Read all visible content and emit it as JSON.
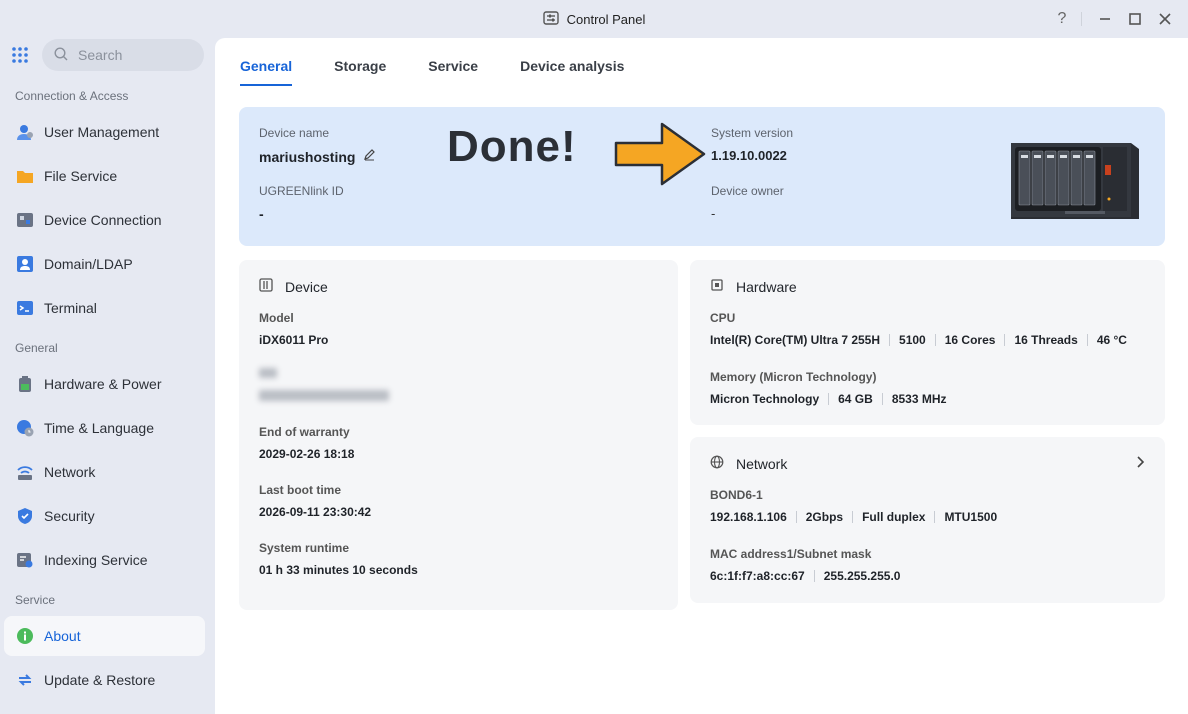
{
  "window": {
    "title": "Control Panel",
    "help": "?"
  },
  "search": {
    "placeholder": "Search"
  },
  "sidebar": {
    "sections": [
      "Connection & Access",
      "General",
      "Service"
    ],
    "items": [
      {
        "label": "User Management",
        "icon": "user-icon"
      },
      {
        "label": "File Service",
        "icon": "folder-icon"
      },
      {
        "label": "Device Connection",
        "icon": "device-connection-icon"
      },
      {
        "label": "Domain/LDAP",
        "icon": "domain-icon"
      },
      {
        "label": "Terminal",
        "icon": "terminal-icon"
      },
      {
        "label": "Hardware & Power",
        "icon": "battery-icon"
      },
      {
        "label": "Time & Language",
        "icon": "globe-clock-icon"
      },
      {
        "label": "Network",
        "icon": "network-icon"
      },
      {
        "label": "Security",
        "icon": "shield-icon"
      },
      {
        "label": "Indexing Service",
        "icon": "index-icon"
      },
      {
        "label": "About",
        "icon": "info-icon",
        "active": true
      },
      {
        "label": "Update & Restore",
        "icon": "update-icon"
      }
    ]
  },
  "tabs": [
    {
      "label": "General",
      "active": true
    },
    {
      "label": "Storage"
    },
    {
      "label": "Service"
    },
    {
      "label": "Device analysis"
    }
  ],
  "banner": {
    "device_name_label": "Device name",
    "device_name": "mariushosting",
    "ugreenlink_label": "UGREENlink ID",
    "ugreenlink_value": "-",
    "system_version_label": "System version",
    "system_version": "1.19.10.0022",
    "device_owner_label": "Device owner",
    "device_owner_value": "-",
    "overlay_text": "Done!"
  },
  "device_card": {
    "title": "Device",
    "model_label": "Model",
    "model": "iDX6011 Pro",
    "warranty_label": "End of warranty",
    "warranty": "2029-02-26 18:18",
    "boot_label": "Last boot time",
    "boot": "2026-09-11 23:30:42",
    "runtime_label": "System runtime",
    "runtime": "01 h 33 minutes 10 seconds"
  },
  "hardware_card": {
    "title": "Hardware",
    "cpu_label": "CPU",
    "cpu_values": [
      "Intel(R) Core(TM) Ultra 7 255H",
      "5100",
      "16 Cores",
      "16 Threads",
      "46 °C"
    ],
    "memory_label": "Memory (Micron Technology)",
    "memory_values": [
      "Micron Technology",
      "64 GB",
      "8533 MHz"
    ]
  },
  "network_card": {
    "title": "Network",
    "bond_label": "BOND6-1",
    "bond_values": [
      "192.168.1.106",
      "2Gbps",
      "Full duplex",
      "MTU1500"
    ],
    "mac_label": "MAC address1/Subnet mask",
    "mac_values": [
      "6c:1f:f7:a8:cc:67",
      "255.255.255.0"
    ]
  },
  "colors": {
    "accent": "#1764d8",
    "banner_bg": "#dce9fb",
    "arrow": "#f5a623"
  }
}
